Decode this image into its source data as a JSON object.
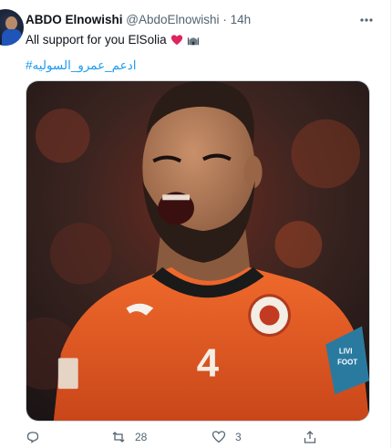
{
  "tweet": {
    "author_name": "ABDO Elnowishi",
    "handle": "@AbdoElnowishi",
    "separator": "·",
    "time": "14h",
    "text": "All support for you ElSolia",
    "hashtag": "#ادعم_عمرو_السوليه"
  },
  "media": {
    "jersey_number": "4",
    "armband_text_1": "LIVI",
    "armband_text_2": "FOOT"
  },
  "actions": {
    "reply_count": "",
    "retweet_count": "28",
    "like_count": "3"
  },
  "icons": {
    "more": "more-horizontal-icon",
    "reply": "reply-icon",
    "retweet": "retweet-icon",
    "like": "heart-outline-icon",
    "share": "share-icon"
  },
  "colors": {
    "link": "#1d9bf0",
    "muted": "#536471",
    "heart": "#e0245e",
    "jersey": "#e2531f"
  }
}
